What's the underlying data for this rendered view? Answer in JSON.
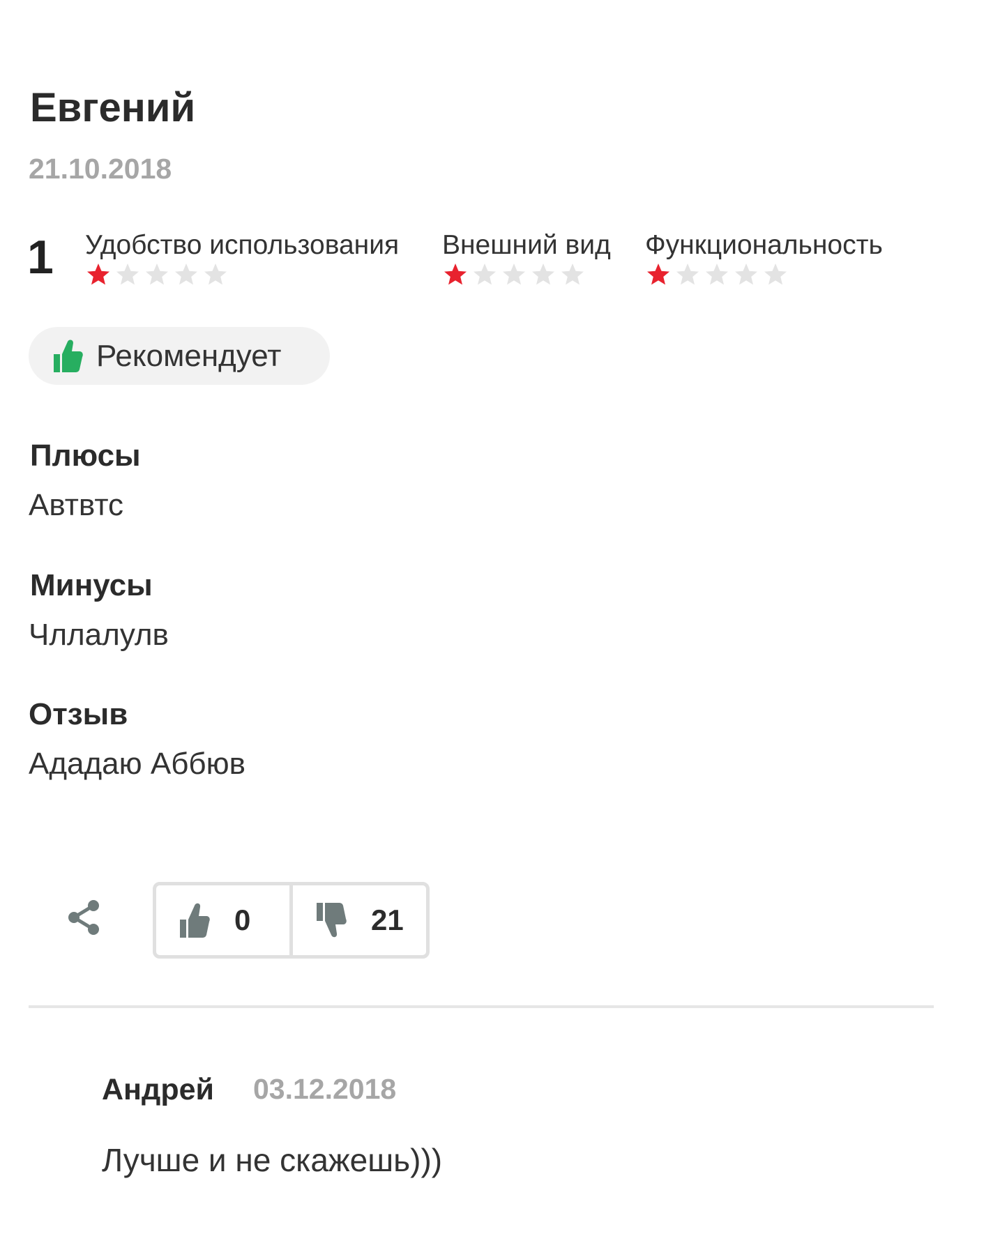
{
  "review": {
    "author": "Евгений",
    "date": "21.10.2018",
    "overall_rating": "1",
    "criteria": [
      {
        "label": "Удобство использования",
        "stars": 1,
        "max": 5
      },
      {
        "label": "Внешний вид",
        "stars": 1,
        "max": 5
      },
      {
        "label": "Функциональность",
        "stars": 1,
        "max": 5
      }
    ],
    "recommend_label": "Рекомендует",
    "pros_title": "Плюсы",
    "pros_text": "Автвтс",
    "cons_title": "Минусы",
    "cons_text": "Чллалулв",
    "body_title": "Отзыв",
    "body_text": "Ададаю Аббюв"
  },
  "votes": {
    "likes": "0",
    "dislikes": "21"
  },
  "comment": {
    "author": "Андрей",
    "date": "03.12.2018",
    "text": "Лучше и не скажешь)))"
  },
  "colors": {
    "star_active": "#e8222e",
    "star_inactive": "#e3e3e3",
    "recommend_thumb": "#27ae60",
    "vote_icon": "#6f7b7b",
    "muted_text": "#a6a6a6"
  },
  "icons": {
    "recommend": "thumbs-up-icon",
    "share": "share-icon",
    "like": "thumbs-up-icon",
    "dislike": "thumbs-down-icon",
    "star": "star-icon"
  }
}
